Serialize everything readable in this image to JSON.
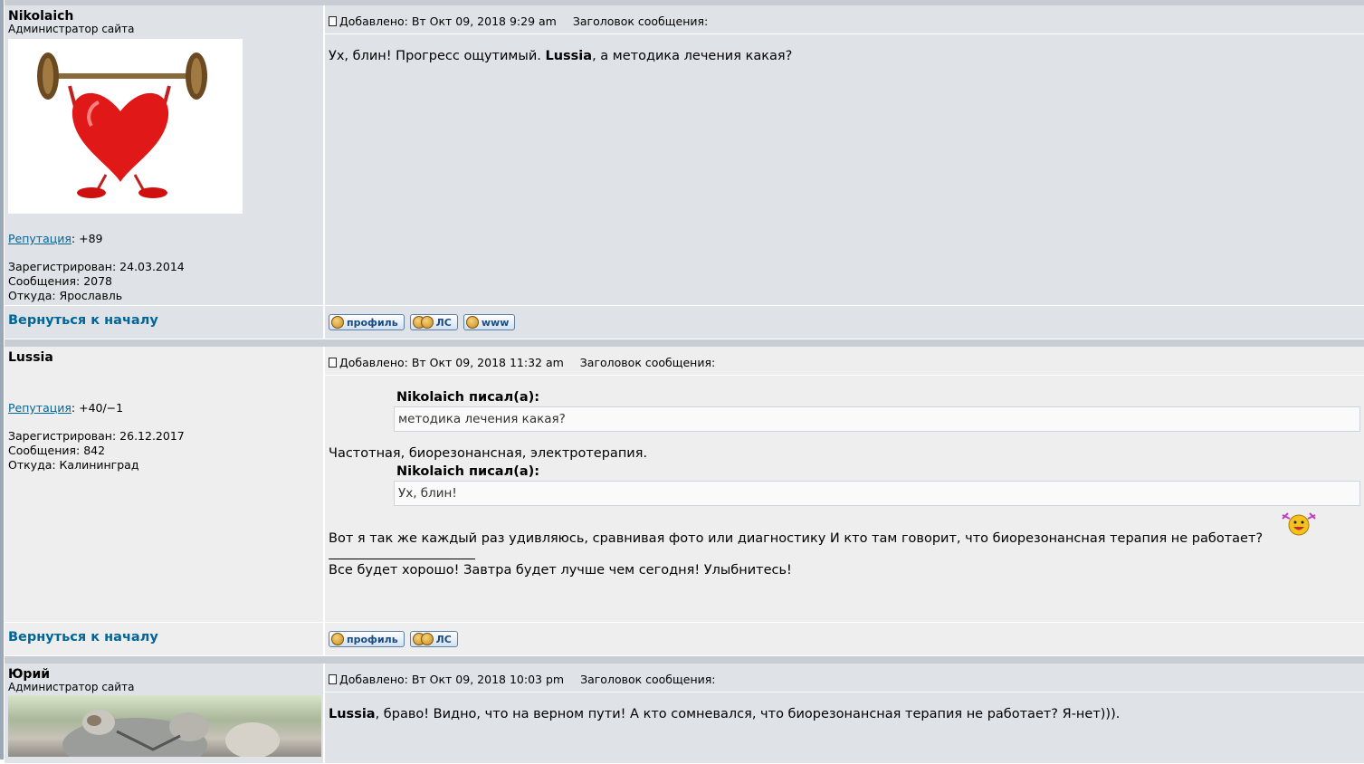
{
  "posts": [
    {
      "author": "Nikolaich",
      "rank": "Администратор сайта",
      "rep_label": "Репутация",
      "rep_value": ": +89",
      "registered": "Зарегистрирован: 24.03.2014",
      "messages": "Сообщения: 2078",
      "from": "Откуда: Ярославль",
      "date": "Добавлено: Вт Окт 09, 2018 9:29 am",
      "subject_label": "Заголовок сообщения:",
      "text_a": "Ух, блин! Прогресс ощутимый. ",
      "text_bold": "Lussia",
      "text_b": ", а методика лечения какая?"
    },
    {
      "author": "Lussia",
      "rep_label": "Репутация",
      "rep_value": ": +40/−1",
      "registered": "Зарегистрирован: 26.12.2017",
      "messages": "Сообщения: 842",
      "from": "Откуда: Калининград",
      "date": "Добавлено: Вт Окт 09, 2018 11:32 am",
      "subject_label": "Заголовок сообщения:",
      "quote1_title": "Nikolaich писал(а):",
      "quote1_text": "методика лечения какая?",
      "reply1": "Частотная, биорезонансная, электротерапия.",
      "quote2_title": "Nikolaich писал(а):",
      "quote2_text": "Ух, блин!",
      "reply2": "Вот я так же каждый раз удивляюсь, сравнивая фото или диагностику И кто там говорит, что биорезонансная терапия не работает?",
      "signature": "Все будет хорошо! Завтра будет лучше чем сегодня! Улыбнитесь!"
    },
    {
      "author": "Юрий",
      "rank": "Администратор сайта",
      "date": "Добавлено: Вт Окт 09, 2018 10:03 pm",
      "subject_label": "Заголовок сообщения:",
      "text_bold": "Lussia",
      "text_b": ", браво! Видно, что на верном пути! А кто сомневался, что биорезонансная терапия не работает? Я-нет)))."
    }
  ],
  "footer": {
    "back_to_top": "Вернуться к началу",
    "profile_btn": "профиль",
    "pm_btn": "ЛС",
    "www_btn": "www"
  },
  "colors": {
    "link": "#006699",
    "row_alt1": "#dfe3e8",
    "row_alt2": "#eeeeee",
    "separator": "#c8cdd3"
  }
}
